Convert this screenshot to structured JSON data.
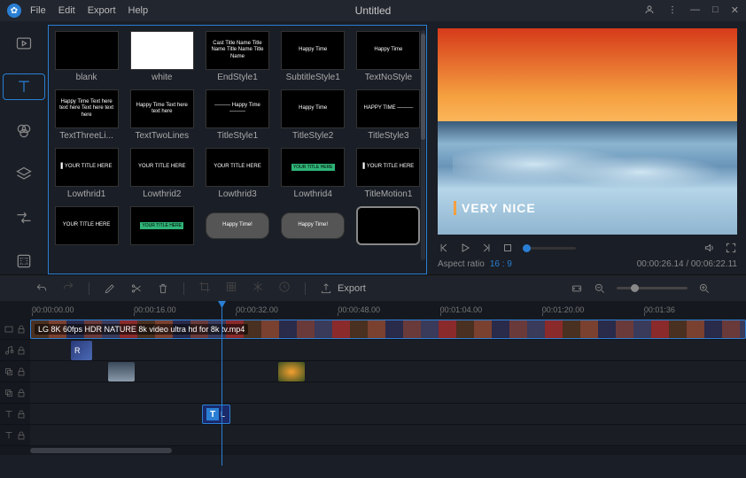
{
  "menu": {
    "file": "File",
    "edit": "Edit",
    "export": "Export",
    "help": "Help"
  },
  "title": "Untitled",
  "gallery": {
    "items": [
      {
        "label": "blank",
        "preview": ""
      },
      {
        "label": "white",
        "preview": "",
        "white": true
      },
      {
        "label": "EndStyle1",
        "preview": "Cast\nTitle Name\nTitle Name\nTitle Name\nTitle Name"
      },
      {
        "label": "SubtitleStyle1",
        "preview": "Happy Time"
      },
      {
        "label": "TextNoStyle",
        "preview": "Happy Time"
      },
      {
        "label": "TextThreeLi...",
        "preview": "Happy Time\nText here text here\nText here text here"
      },
      {
        "label": "TextTwoLines",
        "preview": "Happy Time\nText here text here"
      },
      {
        "label": "TitleStyle1",
        "preview": "———\nHappy Time\n———"
      },
      {
        "label": "TitleStyle2",
        "preview": "Happy Time"
      },
      {
        "label": "TitleStyle3",
        "preview": "HAPPY TIME\n———"
      },
      {
        "label": "Lowthrid1",
        "preview": "▌YOUR TITLE HERE"
      },
      {
        "label": "Lowthrid2",
        "preview": "YOUR TITLE HERE"
      },
      {
        "label": "Lowthrid3",
        "preview": "YOUR TITLE HERE"
      },
      {
        "label": "Lowthrid4",
        "preview": "YOUR TITLE HERE",
        "accent": true
      },
      {
        "label": "TitleMotion1",
        "preview": "▌YOUR TITLE HERE"
      },
      {
        "label": "",
        "preview": "YOUR TITLE HERE"
      },
      {
        "label": "",
        "preview": "YOUR TITLE HERE",
        "accent": true
      },
      {
        "label": "",
        "preview": "Happy Time!",
        "badge": true
      },
      {
        "label": "",
        "preview": "Happy Time!",
        "badge": true
      },
      {
        "label": "",
        "preview": "",
        "ornate": true
      }
    ]
  },
  "preview": {
    "overlay": "VERY NICE",
    "aspect_label": "Aspect ratio",
    "aspect_value": "16 : 9",
    "time": "00:00:26.14 / 00:06:22.11"
  },
  "toolbar": {
    "export": "Export"
  },
  "ruler": [
    "00:00:00.00",
    "00:00:16.00",
    "00:00:32.00",
    "00:00:48.00",
    "00:01:04.00",
    "00:01:20.00",
    "00:01:36"
  ],
  "tracks": {
    "video_clip": "LG 8K 60fps HDR NATURE 8k video ultra hd for 8k tv.mp4",
    "audio_label": "R",
    "text_icon": "T",
    "text_label": "L"
  }
}
